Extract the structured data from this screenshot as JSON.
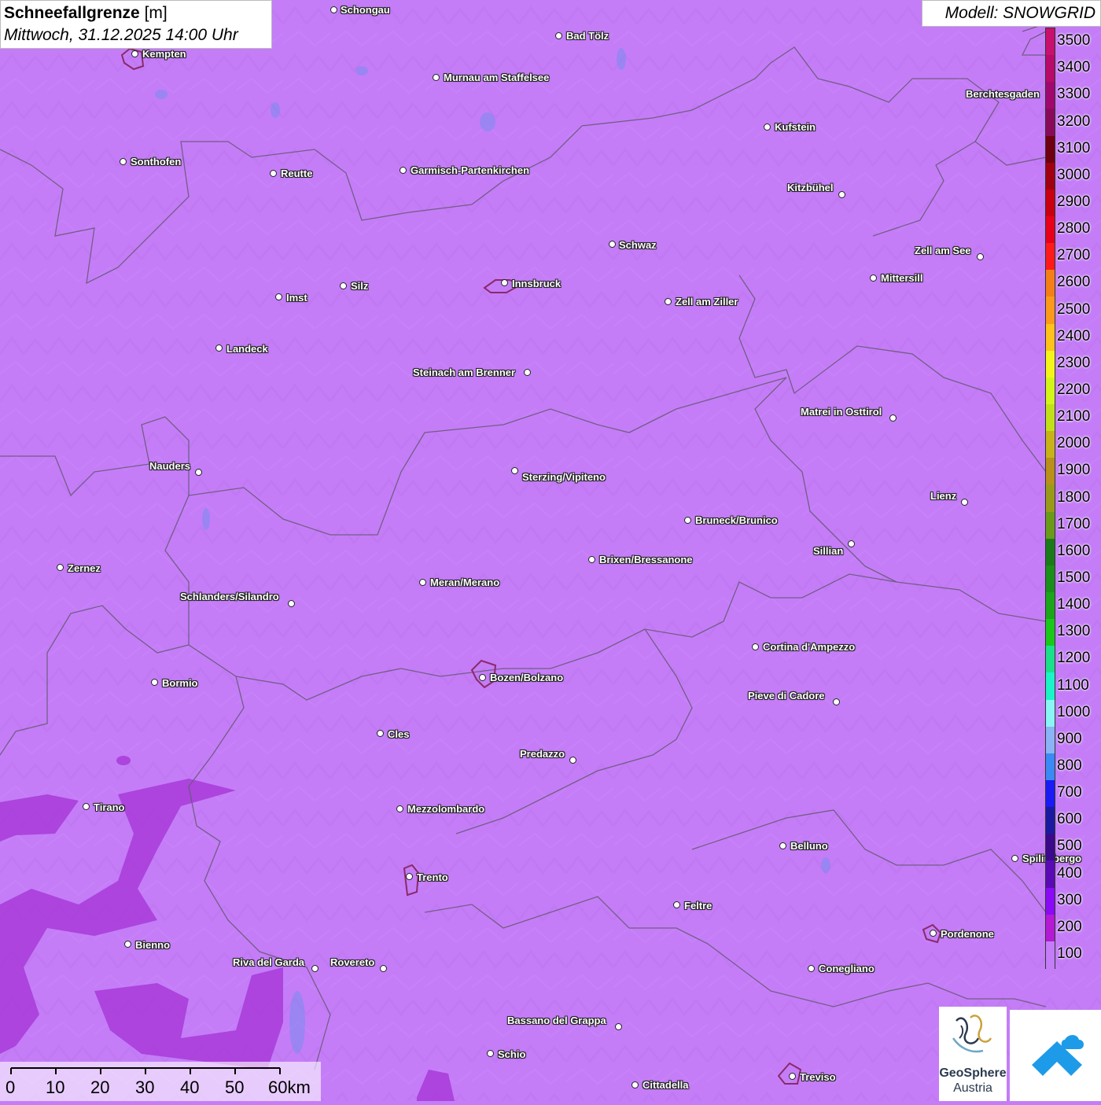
{
  "title": {
    "quantity": "Schneefallgrenze",
    "unit": "[m]",
    "datetime": "Mittwoch, 31.12.2025 14:00 Uhr"
  },
  "model": "Modell: SNOWGRID",
  "legend": {
    "labels": [
      "3500",
      "3400",
      "3300",
      "3200",
      "3100",
      "3000",
      "2900",
      "2800",
      "2700",
      "2600",
      "2500",
      "2400",
      "2300",
      "2200",
      "2100",
      "2000",
      "1900",
      "1800",
      "1700",
      "1600",
      "1500",
      "1400",
      "1300",
      "1200",
      "1100",
      "1000",
      "900",
      "800",
      "700",
      "600",
      "500",
      "400",
      "300",
      "200",
      "100"
    ],
    "colors": [
      "#c8106e",
      "#b80a69",
      "#a00870",
      "#8a0a5a",
      "#6e0010",
      "#a00010",
      "#c80010",
      "#e8001a",
      "#ff1a1a",
      "#f57f17",
      "#fb9a1a",
      "#ffc21a",
      "#f5f51a",
      "#d4f51a",
      "#c2e01a",
      "#c8b21a",
      "#b8901a",
      "#9a9a1a",
      "#6a9a1a",
      "#1a7a1a",
      "#1a8f1a",
      "#1aa51a",
      "#1ac81a",
      "#1ae08a",
      "#1af5c8",
      "#8af5f5",
      "#8ab4f5",
      "#3a8af5",
      "#1a1af5",
      "#1a1aa0",
      "#3a0a8a",
      "#5a0ab4",
      "#8a0af5",
      "#b41ad4",
      "#c47df7"
    ]
  },
  "cities": [
    {
      "name": "Schongau",
      "dot": [
        425,
        13
      ],
      "label": [
        433,
        6
      ]
    },
    {
      "name": "Bad Tölz",
      "dot": [
        711,
        46
      ],
      "label": [
        720,
        39
      ]
    },
    {
      "name": "Kempten",
      "dot": [
        172,
        69
      ],
      "label": [
        181,
        62
      ]
    },
    {
      "name": "Murnau am Staffelsee",
      "dot": [
        555,
        99
      ],
      "label": [
        564,
        92
      ]
    },
    {
      "name": "Berchtesgaden",
      "dot": [
        1336,
        121
      ],
      "label": [
        1228,
        113
      ]
    },
    {
      "name": "Kufstein",
      "dot": [
        976,
        162
      ],
      "label": [
        985,
        155
      ]
    },
    {
      "name": "Sonthofen",
      "dot": [
        157,
        206
      ],
      "label": [
        166,
        199
      ]
    },
    {
      "name": "Reutte",
      "dot": [
        348,
        221
      ],
      "label": [
        357,
        214
      ]
    },
    {
      "name": "Garmisch-Partenkirchen",
      "dot": [
        513,
        217
      ],
      "label": [
        522,
        210
      ]
    },
    {
      "name": "Kitzbühel",
      "dot": [
        1071,
        248
      ],
      "label": [
        1001,
        232
      ]
    },
    {
      "name": "Schwaz",
      "dot": [
        779,
        311
      ],
      "label": [
        787,
        305
      ]
    },
    {
      "name": "Zell am See",
      "dot": [
        1247,
        327
      ],
      "label": [
        1163,
        312
      ]
    },
    {
      "name": "Mittersill",
      "dot": [
        1111,
        354
      ],
      "label": [
        1120,
        347
      ]
    },
    {
      "name": "Innsbruck",
      "dot": [
        642,
        360
      ],
      "label": [
        651,
        354
      ]
    },
    {
      "name": "Silz",
      "dot": [
        437,
        364
      ],
      "label": [
        446,
        357
      ]
    },
    {
      "name": "Imst",
      "dot": [
        355,
        378
      ],
      "label": [
        364,
        372
      ]
    },
    {
      "name": "Zell am Ziller",
      "dot": [
        850,
        384
      ],
      "label": [
        859,
        377
      ]
    },
    {
      "name": "Landeck",
      "dot": [
        279,
        443
      ],
      "label": [
        288,
        437
      ]
    },
    {
      "name": "Steinach am Brenner",
      "dot": [
        671,
        474
      ],
      "label": [
        525,
        467
      ]
    },
    {
      "name": "Matrei in Osttirol",
      "dot": [
        1136,
        532
      ],
      "label": [
        1018,
        517
      ]
    },
    {
      "name": "Nauders",
      "dot": [
        253,
        601
      ],
      "label": [
        190,
        586
      ]
    },
    {
      "name": "Sterzing/Vipiteno",
      "dot": [
        655,
        599
      ],
      "label": [
        664,
        600
      ]
    },
    {
      "name": "Lienz",
      "dot": [
        1227,
        639
      ],
      "label": [
        1183,
        624
      ]
    },
    {
      "name": "Bruneck/Brunico",
      "dot": [
        875,
        662
      ],
      "label": [
        884,
        655
      ]
    },
    {
      "name": "Sillian",
      "dot": [
        1083,
        692
      ],
      "label": [
        1034,
        694
      ]
    },
    {
      "name": "Brixen/Bressanone",
      "dot": [
        753,
        712
      ],
      "label": [
        762,
        705
      ]
    },
    {
      "name": "Zernez",
      "dot": [
        77,
        722
      ],
      "label": [
        86,
        716
      ]
    },
    {
      "name": "Meran/Merano",
      "dot": [
        538,
        741
      ],
      "label": [
        547,
        734
      ]
    },
    {
      "name": "Schlanders/Silandro",
      "dot": [
        371,
        768
      ],
      "label": [
        229,
        752
      ]
    },
    {
      "name": "Cortina d'Ampezzo",
      "dot": [
        961,
        823
      ],
      "label": [
        970,
        816
      ]
    },
    {
      "name": "Bozen/Bolzano",
      "dot": [
        614,
        862
      ],
      "label": [
        623,
        855
      ]
    },
    {
      "name": "Bormio",
      "dot": [
        197,
        868
      ],
      "label": [
        206,
        862
      ]
    },
    {
      "name": "Pieve di Cadore",
      "dot": [
        1064,
        893
      ],
      "label": [
        951,
        878
      ]
    },
    {
      "name": "Cles",
      "dot": [
        484,
        933
      ],
      "label": [
        493,
        927
      ]
    },
    {
      "name": "Predazzo",
      "dot": [
        729,
        967
      ],
      "label": [
        661,
        952
      ]
    },
    {
      "name": "Tirano",
      "dot": [
        110,
        1026
      ],
      "label": [
        119,
        1020
      ]
    },
    {
      "name": "Mezzolombardo",
      "dot": [
        509,
        1029
      ],
      "label": [
        518,
        1022
      ]
    },
    {
      "name": "Belluno",
      "dot": [
        996,
        1076
      ],
      "label": [
        1005,
        1069
      ]
    },
    {
      "name": "Spilimbergo",
      "dot": [
        1291,
        1092
      ],
      "label": [
        1300,
        1085
      ]
    },
    {
      "name": "Trento",
      "dot": [
        521,
        1115
      ],
      "label": [
        530,
        1109
      ]
    },
    {
      "name": "Feltre",
      "dot": [
        861,
        1151
      ],
      "label": [
        870,
        1145
      ]
    },
    {
      "name": "Pordenone",
      "dot": [
        1187,
        1187
      ],
      "label": [
        1196,
        1181
      ]
    },
    {
      "name": "Bienno",
      "dot": [
        163,
        1201
      ],
      "label": [
        172,
        1195
      ]
    },
    {
      "name": "Riva del Garda",
      "dot": [
        401,
        1232
      ],
      "label": [
        296,
        1217
      ]
    },
    {
      "name": "Rovereto",
      "dot": [
        488,
        1232
      ],
      "label": [
        420,
        1217
      ]
    },
    {
      "name": "Conegliano",
      "dot": [
        1032,
        1232
      ],
      "label": [
        1041,
        1225
      ]
    },
    {
      "name": "Bassano del Grappa",
      "dot": [
        787,
        1306
      ],
      "label": [
        645,
        1291
      ]
    },
    {
      "name": "Schio",
      "dot": [
        624,
        1340
      ],
      "label": [
        633,
        1334
      ]
    },
    {
      "name": "Treviso",
      "dot": [
        1008,
        1369
      ],
      "label": [
        1017,
        1363
      ]
    },
    {
      "name": "Cittadella",
      "dot": [
        808,
        1380
      ],
      "label": [
        817,
        1373
      ]
    }
  ],
  "scale_bar": {
    "ticks": [
      "0",
      "10",
      "20",
      "30",
      "40",
      "50",
      "60km"
    ]
  },
  "logos": {
    "geosphere_line1": "GeoSphere",
    "geosphere_line2": "Austria"
  }
}
